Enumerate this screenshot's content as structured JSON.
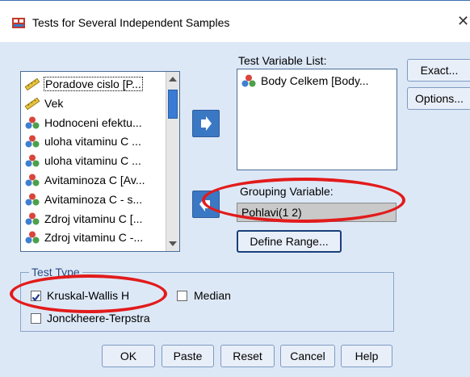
{
  "window": {
    "title": "Tests for Several Independent Samples",
    "close_glyph": "✕"
  },
  "variables": {
    "items": [
      {
        "label": "Poradove cislo [P...",
        "icon": "ruler-icon",
        "selected": true
      },
      {
        "label": "Vek",
        "icon": "ruler-icon",
        "selected": false
      },
      {
        "label": "Hodnoceni efektu...",
        "icon": "nominal-icon",
        "selected": false
      },
      {
        "label": "uloha vitaminu C ...",
        "icon": "nominal-icon",
        "selected": false
      },
      {
        "label": "uloha vitaminu C ...",
        "icon": "nominal-icon",
        "selected": false
      },
      {
        "label": "Avitaminoza C [Av...",
        "icon": "nominal-icon",
        "selected": false
      },
      {
        "label": "Avitaminoza C - s...",
        "icon": "nominal-icon",
        "selected": false
      },
      {
        "label": "Zdroj vitaminu C [...",
        "icon": "nominal-icon",
        "selected": false
      },
      {
        "label": "Zdroj vitaminu C -...",
        "icon": "nominal-icon",
        "selected": false
      }
    ]
  },
  "test_variable_list": {
    "label": "Test Variable List:",
    "items": [
      {
        "label": "Body Celkem [Body...",
        "icon": "nominal-icon"
      }
    ]
  },
  "grouping": {
    "label": "Grouping Variable:",
    "value": "Pohlavi(1 2)",
    "define_range_label": "Define Range..."
  },
  "side_buttons": {
    "exact_label": "Exact...",
    "options_label": "Options..."
  },
  "test_type": {
    "legend": "Test Type",
    "kruskal_label": "Kruskal-Wallis H",
    "kruskal_checked": true,
    "median_label": "Median",
    "median_checked": false,
    "jonckheere_label": "Jonckheere-Terpstra",
    "jonckheere_checked": false
  },
  "bottom_buttons": {
    "ok": "OK",
    "paste": "Paste",
    "reset": "Reset",
    "cancel": "Cancel",
    "help": "Help"
  },
  "colors": {
    "client_bg": "#dde8f7",
    "arrow_button": "#3b78c4",
    "highlight": "#e21b1b",
    "selection": "#3a7bd5"
  }
}
